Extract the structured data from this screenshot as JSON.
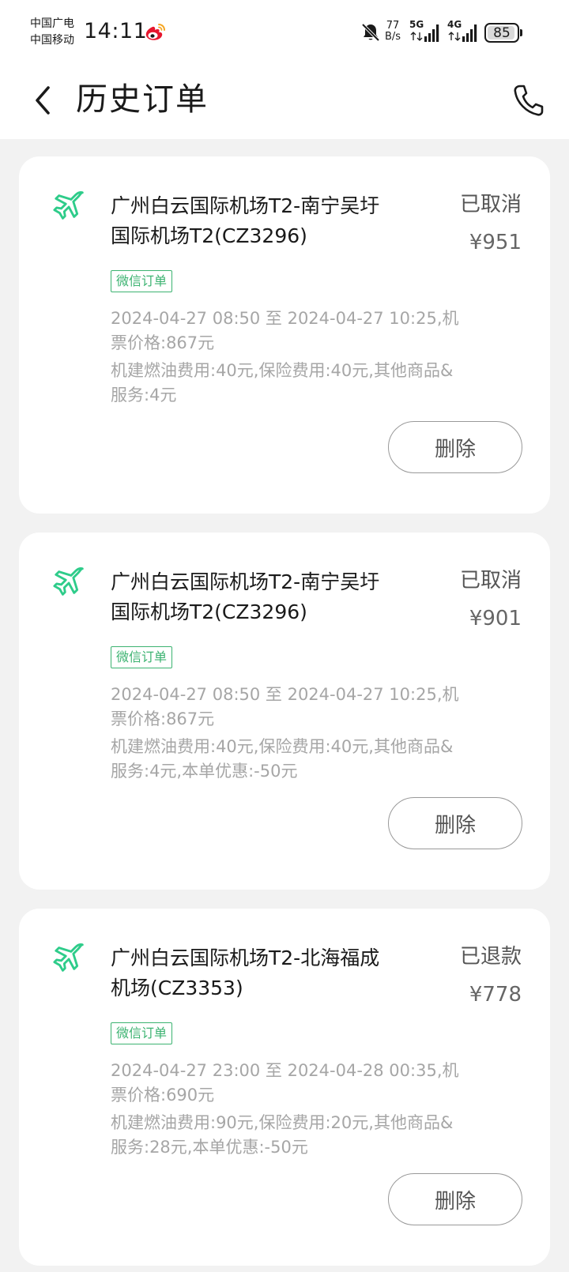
{
  "status_bar": {
    "carrier_1": "中国广电",
    "carrier_2": "中国移动",
    "time": "14:11",
    "net_speed_value": "77",
    "net_speed_unit": "B/s",
    "signal_1_label": "5G",
    "signal_2_label": "4G",
    "battery_level": "85"
  },
  "header": {
    "title": "历史订单",
    "back_icon": "chevron-left-icon",
    "phone_icon": "phone-icon"
  },
  "orders": [
    {
      "route_line1": "广州白云国际机场T2-南宁吴圩",
      "route_line2": "国际机场T2(CZ3296)",
      "status": "已取消",
      "price": "¥951",
      "source_tag": "微信订单",
      "time_line1": "2024-04-27 08:50 至 2024-04-27 10:25,机",
      "time_line2": "票价格:867元",
      "fee_line1": "机建燃油费用:40元,保险费用:40元,其他商品&",
      "fee_line2": "服务:4元",
      "delete_label": "删除"
    },
    {
      "route_line1": "广州白云国际机场T2-南宁吴圩",
      "route_line2": "国际机场T2(CZ3296)",
      "status": "已取消",
      "price": "¥901",
      "source_tag": "微信订单",
      "time_line1": "2024-04-27 08:50 至 2024-04-27 10:25,机",
      "time_line2": "票价格:867元",
      "fee_line1": "机建燃油费用:40元,保险费用:40元,其他商品&",
      "fee_line2": "服务:4元,本单优惠:-50元",
      "delete_label": "删除"
    },
    {
      "route_line1": "广州白云国际机场T2-北海福成",
      "route_line2": "机场(CZ3353)",
      "status": "已退款",
      "price": "¥778",
      "source_tag": "微信订单",
      "time_line1": "2024-04-27 23:00 至 2024-04-28 00:35,机",
      "time_line2": "票价格:690元",
      "fee_line1": "机建燃油费用:90元,保险费用:20元,其他商品&",
      "fee_line2": "服务:28元,本单优惠:-50元",
      "delete_label": "删除"
    }
  ],
  "colors": {
    "accent_green": "#2ecc8a",
    "tag_green": "#3cb371",
    "muted_text": "#a6a6a6",
    "background": "#f2f2f2"
  }
}
